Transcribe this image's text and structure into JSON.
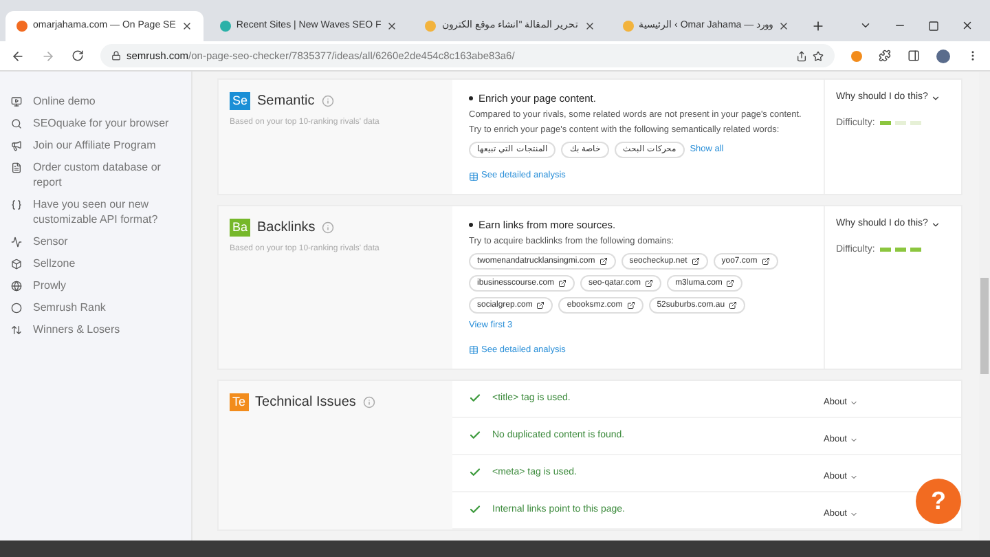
{
  "browser": {
    "tabs": [
      {
        "title": "omarjahama.com — On Page SE",
        "selected": true,
        "color": "#f26b21"
      },
      {
        "title": "Recent Sites | New Waves SEO F",
        "selected": false,
        "color": "#2bb1a8"
      },
      {
        "title": "تحرير المقالة \"انشاء موقع الكترون",
        "selected": false,
        "color": "#f2b33d"
      },
      {
        "title": "الرئيسية ‹ Omar Jahama — وورد",
        "selected": false,
        "color": "#f2b33d"
      }
    ],
    "address_host": "semrush.com",
    "address_path": "/on-page-seo-checker/7835377/ideas/all/6260e2de454c8c163abe83a6/"
  },
  "sidebar": {
    "items": [
      {
        "label": "Online demo"
      },
      {
        "label": "SEOquake for your browser"
      },
      {
        "label": "Join our Affiliate Program"
      },
      {
        "label": "Order custom database or report"
      },
      {
        "label": "Have you seen our new customizable API format?"
      },
      {
        "label": "Sensor"
      },
      {
        "label": "Sellzone"
      },
      {
        "label": "Prowly"
      },
      {
        "label": "Semrush Rank"
      },
      {
        "label": "Winners & Losers"
      }
    ]
  },
  "sections": [
    {
      "badge": "Se",
      "color": "#1a8fd6",
      "title": "Semantic",
      "subtitle": "Based on your top 10-ranking rivals' data",
      "kind": "idea",
      "heading": "Enrich your page content.",
      "lines": [
        "Compared to your rivals, some related words are not present in your page's content.",
        "Try to enrich your page's content with the following semantically related words:"
      ],
      "chips": [
        "محركات البحث",
        "خاصة بك",
        "المنتجات التي تبيعها"
      ],
      "chips_external": false,
      "chips_link": "Show all",
      "analysis_link": "See detailed analysis",
      "why": "Why should I do this?",
      "difficulty_label": "Difficulty:",
      "level": 0.33
    },
    {
      "badge": "Ba",
      "color": "#76b82a",
      "title": "Backlinks",
      "subtitle": "Based on your top 10-ranking rivals' data",
      "kind": "idea",
      "heading": "Earn links from more sources.",
      "lines": [
        "Try to acquire backlinks from the following domains:"
      ],
      "chips": [
        "twomenandatrucklansingmi.com",
        "seocheckup.net",
        "yoo7.com",
        "ibusinesscourse.com",
        "seo-qatar.com",
        "m3luma.com",
        "socialgrep.com",
        "ebooksmz.com",
        "52suburbs.com.au"
      ],
      "chips_external": true,
      "chips_link": "View first 3",
      "analysis_link": "See detailed analysis",
      "why": "Why should I do this?",
      "difficulty_label": "Difficulty:",
      "level": 1
    },
    {
      "badge": "Te",
      "color": "#f28c1c",
      "title": "Technical Issues",
      "kind": "checks",
      "checks": [
        {
          "text": "<title> tag is used.",
          "about": "About"
        },
        {
          "text": "No duplicated content is found.",
          "about": "About"
        },
        {
          "text": "<meta> tag is used.",
          "about": "About"
        },
        {
          "text": "Internal links point to this page.",
          "about": "About"
        }
      ]
    }
  ],
  "help_button": "?"
}
